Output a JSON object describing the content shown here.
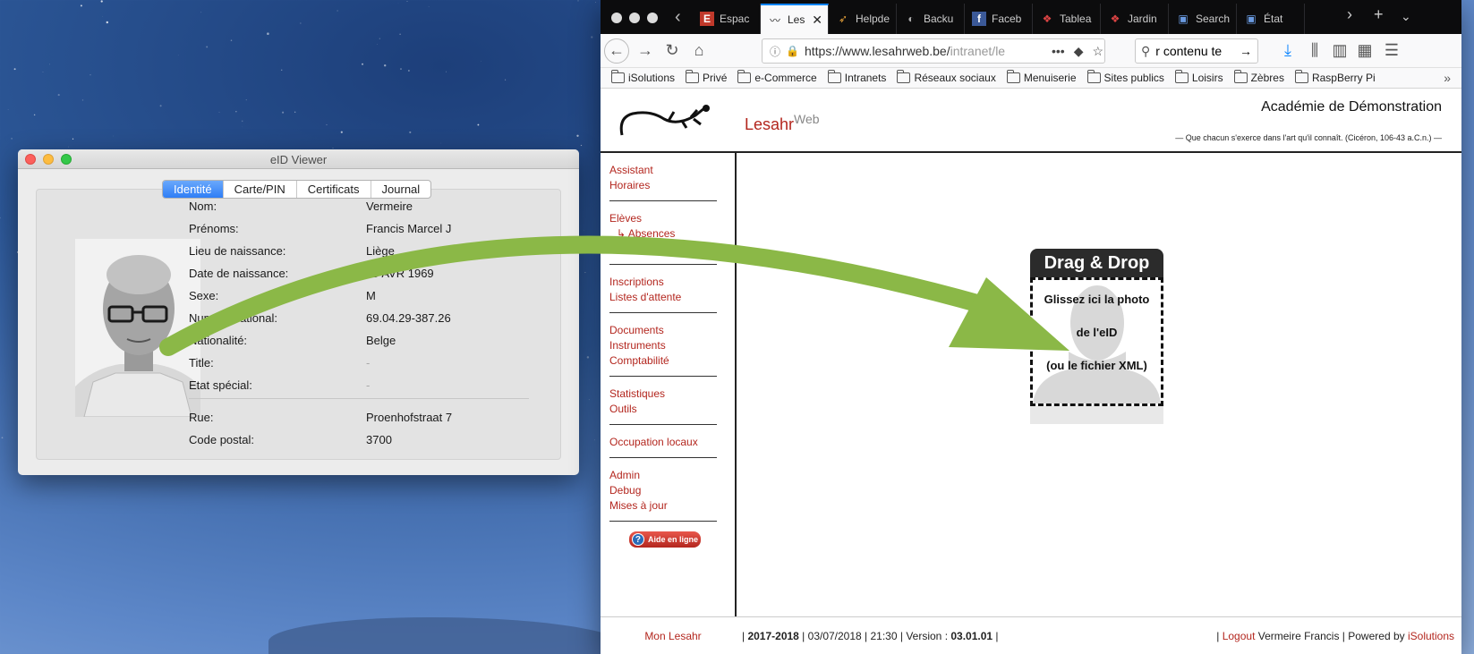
{
  "eid_viewer": {
    "title": "eID Viewer",
    "tabs": [
      "Identité",
      "Carte/PIN",
      "Certificats",
      "Journal"
    ],
    "active_tab": "Identité",
    "fields": [
      {
        "label": "Nom:",
        "value": "Vermeire"
      },
      {
        "label": "Prénoms:",
        "value": "Francis Marcel  J"
      },
      {
        "label": "Lieu de naissance:",
        "value": "Liège"
      },
      {
        "label": "Date de naissance:",
        "value": "29 AVR  1969"
      },
      {
        "label": "Sexe:",
        "value": "M"
      },
      {
        "label": "Numéro national:",
        "value": "69.04.29-387.26"
      },
      {
        "label": "Nationalité:",
        "value": "Belge"
      },
      {
        "label": "Title:",
        "value": "-"
      },
      {
        "label": "Etat spécial:",
        "value": "-"
      }
    ],
    "address": [
      {
        "label": "Rue:",
        "value": "Proenhofstraat 7"
      },
      {
        "label": "Code postal:",
        "value": "3700"
      }
    ]
  },
  "browser": {
    "tabs": [
      {
        "label": "Espac",
        "icon": "E"
      },
      {
        "label": "Les",
        "icon": "lizard",
        "active": true
      },
      {
        "label": "Helpde",
        "icon": "flag"
      },
      {
        "label": "Backu",
        "icon": "elephant"
      },
      {
        "label": "Faceb",
        "icon": "f"
      },
      {
        "label": "Tablea",
        "icon": "puzzle"
      },
      {
        "label": "Jardin",
        "icon": "puzzle"
      },
      {
        "label": "Search",
        "icon": "store"
      },
      {
        "label": "État",
        "icon": "store"
      }
    ],
    "url_main": "https://www.lesahrweb.be/",
    "url_dim": "intranet/le",
    "search_text": "r contenu te",
    "bookmarks": [
      "iSolutions",
      "Privé",
      "e-Commerce",
      "Intranets",
      "Réseaux sociaux",
      "Menuiserie",
      "Sites publics",
      "Loisirs",
      "Zèbres",
      "RaspBerry Pi"
    ]
  },
  "site": {
    "logo_main": "Lesahr",
    "logo_sup": "Web",
    "academy": "Académie de Démonstration",
    "motto": "— Que chacun s'exerce dans l'art qu'il connaît. (Cicéron, 106-43 a.C.n.) —",
    "nav_groups": [
      [
        "Assistant",
        "Horaires"
      ],
      [
        "Elèves",
        "↳ Absences",
        "Professeurs"
      ],
      [
        "Inscriptions",
        "Listes d'attente"
      ],
      [
        "Documents",
        "Instruments",
        "Comptabilité"
      ],
      [
        "Statistiques",
        "Outils"
      ],
      [
        "Occupation locaux"
      ],
      [
        "Admin",
        "Debug",
        "Mises à jour"
      ]
    ],
    "help_label": "Aide en ligne",
    "dnd_title": "Drag & Drop",
    "dnd_lines": [
      "Glissez ici la photo",
      "de l'eID",
      "(ou le fichier XML)"
    ],
    "footer": {
      "mon": "Mon Lesahr",
      "year": "2017-2018",
      "date": "03/07/2018",
      "time": "21:30",
      "version_label": "Version :",
      "version": "03.01.01",
      "logout": "Logout",
      "user": "Vermeire Francis",
      "powered": "Powered by",
      "vendor": "iSolutions"
    }
  },
  "colors": {
    "link_red": "#b3261e",
    "arrow_green": "#8bb847",
    "tab_blue": "#2f7ef6"
  }
}
